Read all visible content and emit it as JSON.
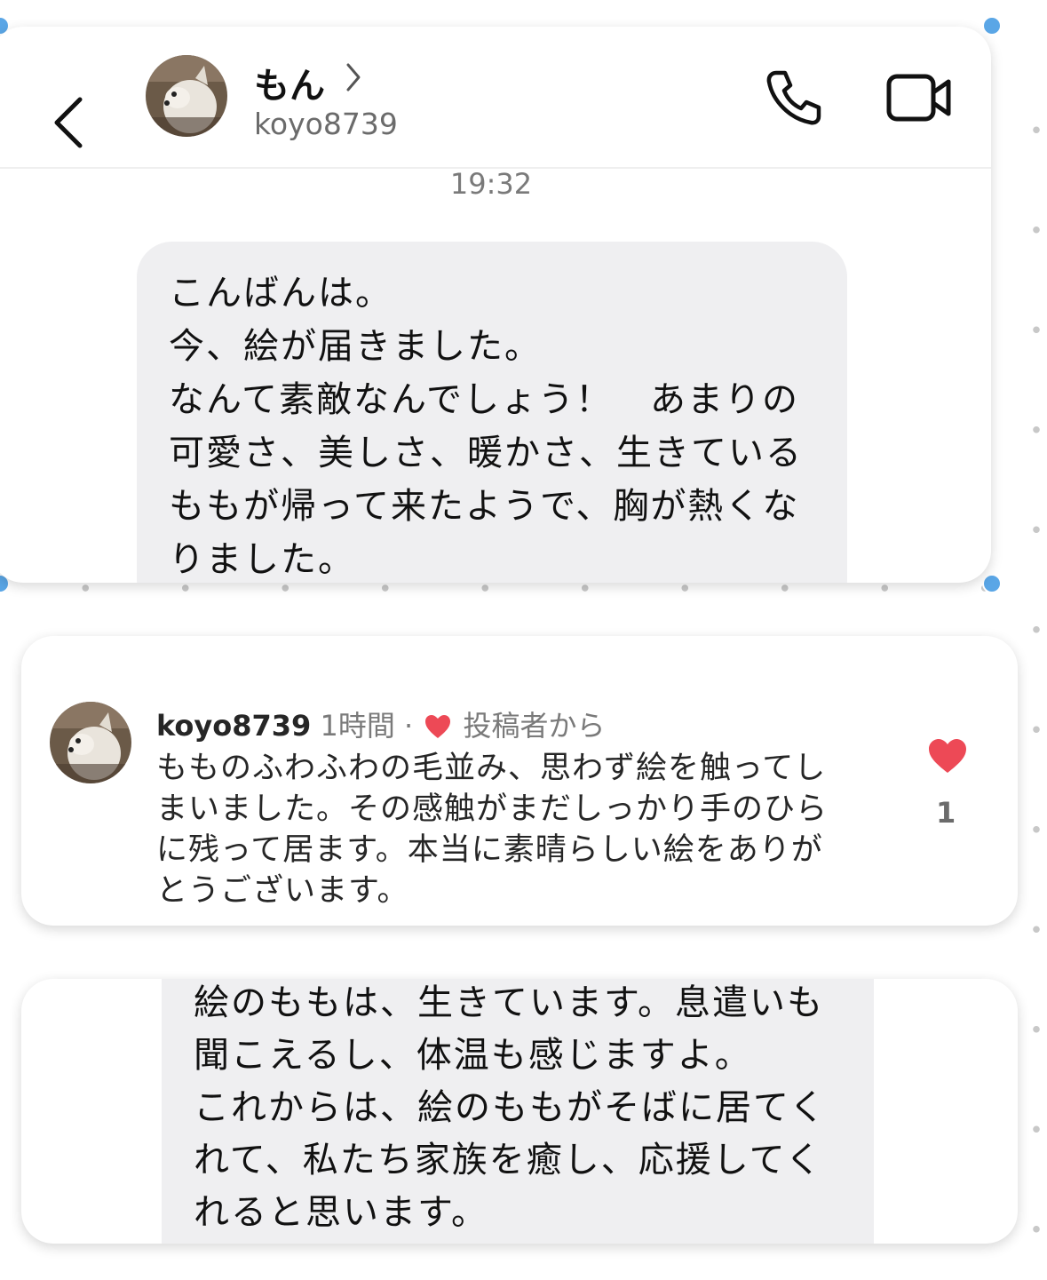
{
  "header": {
    "name": "もん",
    "handle": "koyo8739",
    "back_icon": "chevron-left-icon",
    "call_icon": "phone-icon",
    "video_icon": "video-camera-icon"
  },
  "conversation": {
    "timestamp": "19:32",
    "message_lines": [
      "こんばんは。",
      "今、絵が届きました。",
      "なんて素敵なんでしょう！　あまりの",
      "可愛さ、美しさ、暖かさ、生きている",
      "ももが帰って来たようで、胸が熱くな",
      "りました。"
    ]
  },
  "comment": {
    "username": "koyo8739",
    "time": "1時間",
    "separator": "·",
    "from_author": "投稿者から",
    "body_lines": [
      "もものふわふわの毛並み、思わず絵を触ってし",
      "まいました。その感触がまだしっかり手のひら",
      "に残って居ます。本当に素晴らしい絵をありが",
      "とうございます。"
    ],
    "like_count": "1",
    "like_color": "#ed4956"
  },
  "reply": {
    "lines": [
      "絵のももは、生きています。息遣いも",
      "聞こえるし、体温も感じますよ。",
      "これからは、絵のももがそばに居てく",
      "れて、私たち家族を癒し、応援してく",
      "れると思います。"
    ]
  },
  "colors": {
    "bubble": "#efeff1",
    "selection_handle": "#5aa6e6",
    "secondary_text": "#7a7a7a"
  }
}
